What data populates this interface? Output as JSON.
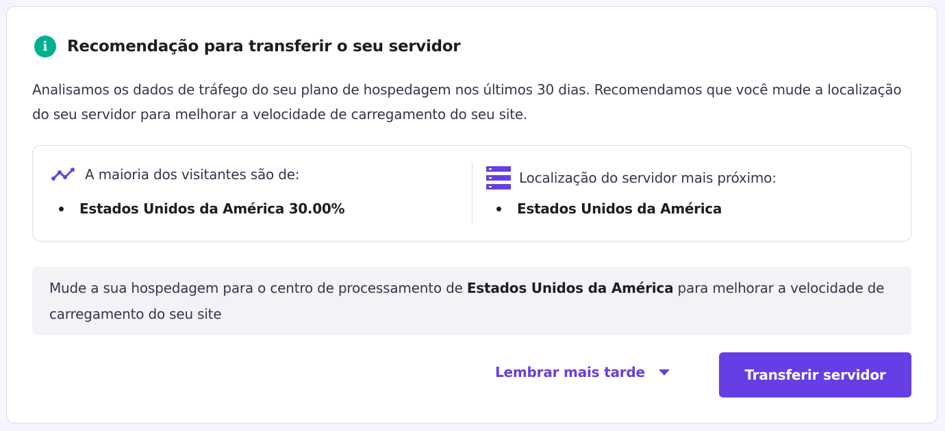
{
  "header": {
    "title": "Recomendação para transferir o seu servidor",
    "icon": "info-icon",
    "icon_glyph": "i"
  },
  "description": "Analisamos os dados de tráfego do seu plano de hospedagem nos últimos 30 dias. Recomendamos que você mude a localização do seu servidor para melhorar a velocidade de carregamento do seu site.",
  "visitors": {
    "icon": "trend-line-icon",
    "label": "A maioria dos visitantes são de:",
    "items": [
      "Estados Unidos da América 30.00%"
    ]
  },
  "server": {
    "icon": "server-icon",
    "label": "Localização do servidor mais próximo:",
    "items": [
      "Estados Unidos da América"
    ]
  },
  "notice": {
    "prefix": "Mude a sua hospedagem para o centro de processamento de ",
    "highlight": "Estados Unidos da América",
    "suffix": " para melhorar a velocidade de carregamento do seu site"
  },
  "actions": {
    "remind_label": "Lembrar mais tarde",
    "transfer_label": "Transferir servidor"
  },
  "colors": {
    "accent": "#673de6",
    "info": "#00b090"
  }
}
